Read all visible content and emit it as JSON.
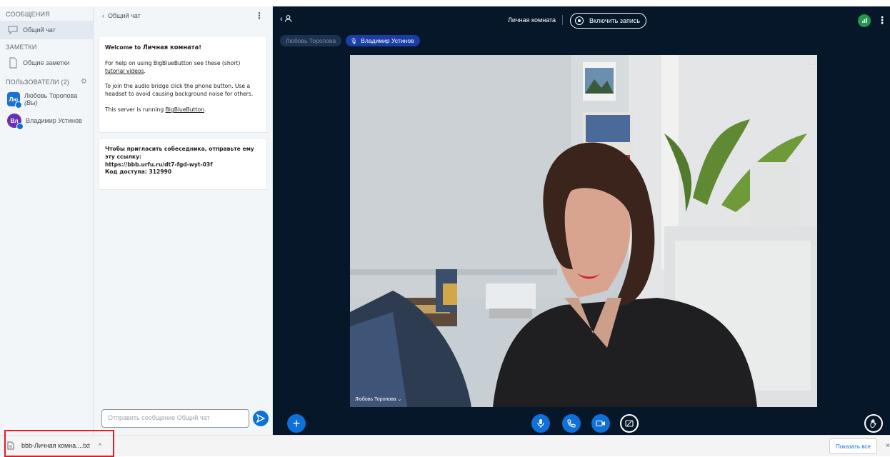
{
  "userlist": {
    "messages_title": "СООБЩЕНИЯ",
    "public_chat_label": "Общий чат",
    "notes_title": "ЗАМЕТКИ",
    "shared_notes_label": "Общие заметки",
    "users_title": "ПОЛЬЗОВАТЕЛИ (2)",
    "users": [
      {
        "initials": "Лю",
        "name": "Любовь Торопова",
        "suffix": "(Вы)",
        "color": "#1c72cf"
      },
      {
        "initials": "Вл",
        "name": "Владимир Устинов",
        "suffix": "",
        "color": "#6b2fb3"
      }
    ]
  },
  "chat": {
    "header_label": "Общий чат",
    "welcome": {
      "line1_prefix": "Welcome to ",
      "room_name": "Личная комната",
      "line1_suffix": "!",
      "help_text": "For help on using BigBlueButton see these (short)",
      "help_link": "tutorial videos",
      "audio_text": "To join the audio bridge click the phone button. Use a headset to avoid causing background noise for others.",
      "server_prefix": "This server is running ",
      "server_link": "BigBlueButton"
    },
    "invite": {
      "text": "Чтобы пригласить собеседника, отправьте ему эту ссылку:",
      "url": "https://bbb.urfu.ru/dt7-fgd-wyt-03f",
      "code_label": "Код доступа:",
      "code": "312990"
    },
    "input_placeholder": "Отправить сообщение Общий чат"
  },
  "main": {
    "room_title": "Личная комната",
    "record_label": "Включить запись",
    "talkers": [
      {
        "name": "Любовь Торопова",
        "active": false
      },
      {
        "name": "Владимир Устинов",
        "active": true
      }
    ],
    "video_label": "Любовь Торопова"
  },
  "downloads": {
    "file_name": "bbb-Личная комна....txt",
    "show_all_label": "Показать все"
  },
  "colors": {
    "accent": "#0f70d7",
    "main_bg": "#06172a",
    "highlight": "#e01b24"
  }
}
